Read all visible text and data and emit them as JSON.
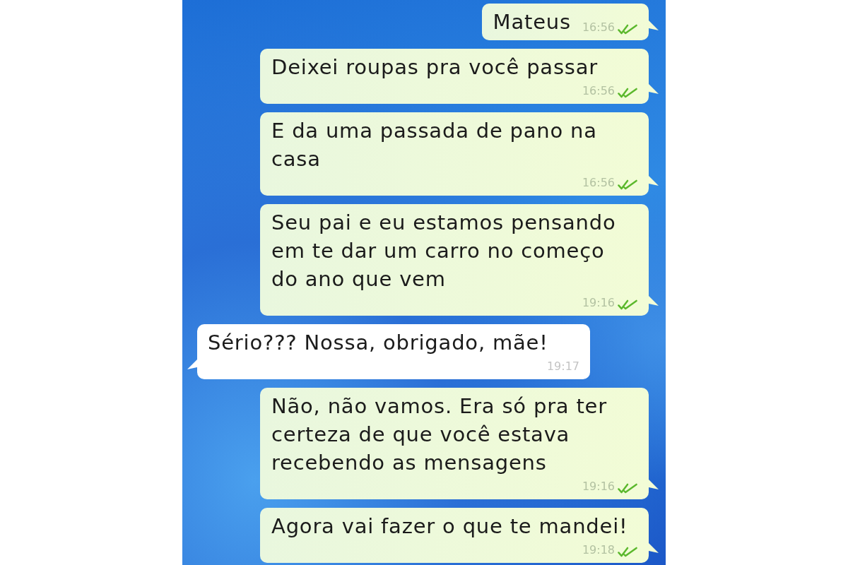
{
  "messages": [
    {
      "kind": "outgoing",
      "text": "Mateus",
      "time": "16:56",
      "delivered": true
    },
    {
      "kind": "outgoing",
      "text": "Deixei roupas pra você passar",
      "time": "16:56",
      "delivered": true
    },
    {
      "kind": "outgoing",
      "text": "E da uma passada de pano na casa",
      "time": "16:56",
      "delivered": true
    },
    {
      "kind": "outgoing",
      "text": "Seu pai e eu estamos pensando em te dar um carro no começo do ano que vem",
      "time": "19:16",
      "delivered": true
    },
    {
      "kind": "incoming",
      "text": "Sério??? Nossa, obrigado, mãe!",
      "time": "19:17"
    },
    {
      "kind": "outgoing",
      "text": "Não, não vamos. Era só pra ter certeza de que você estava recebendo as mensagens",
      "time": "19:16",
      "delivered": true
    },
    {
      "kind": "outgoing",
      "text": "Agora vai fazer o que te mandei!",
      "time": "19:18",
      "delivered": true
    }
  ]
}
